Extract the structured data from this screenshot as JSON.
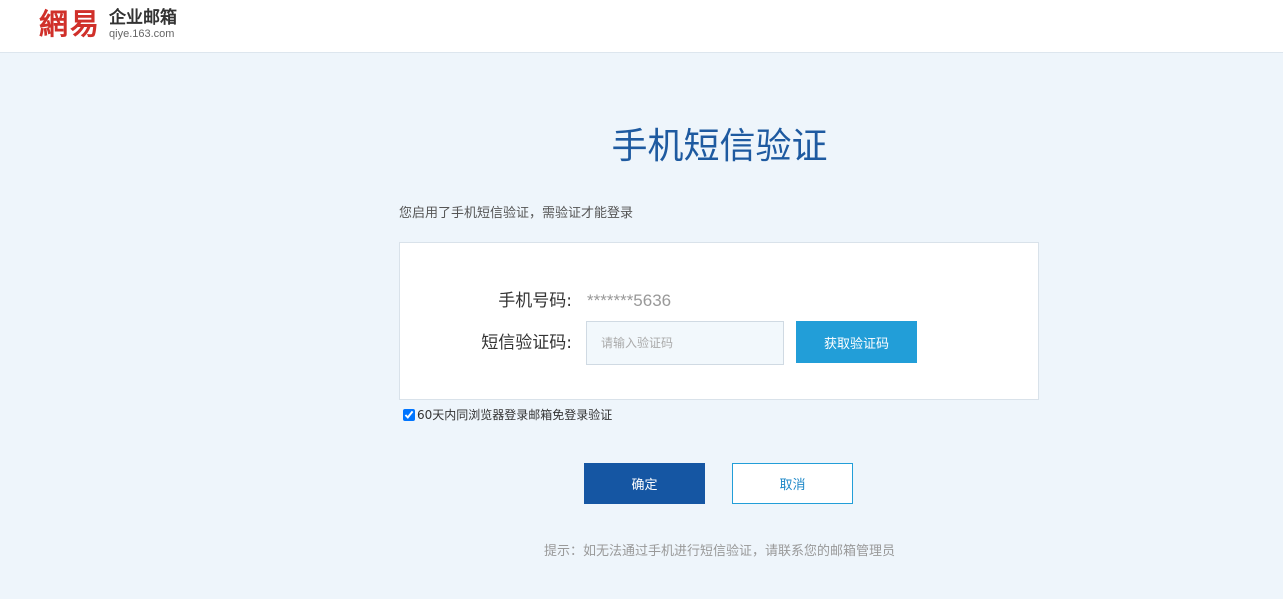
{
  "header": {
    "logo_mark": "網易",
    "logo_title": "企业邮箱",
    "logo_sub": "qiye.163.com"
  },
  "main": {
    "title": "手机短信验证",
    "description": "您启用了手机短信验证，需验证才能登录",
    "phone_label": "手机号码:",
    "phone_value": "*******5636",
    "code_label": "短信验证码:",
    "code_value": "",
    "code_placeholder": "请输入验证码",
    "get_code_label": "获取验证码",
    "remember_label": "60天内同浏览器登录邮箱免登录验证",
    "remember_checked": true,
    "confirm_label": "确定",
    "cancel_label": "取消",
    "tip": "提示：如无法通过手机进行短信验证，请联系您的邮箱管理员"
  },
  "colors": {
    "brand_red": "#d0302a",
    "title_blue": "#1e5aa0",
    "primary_button": "#1556a3",
    "secondary_button": "#229ed8",
    "background": "#eef5fb"
  }
}
